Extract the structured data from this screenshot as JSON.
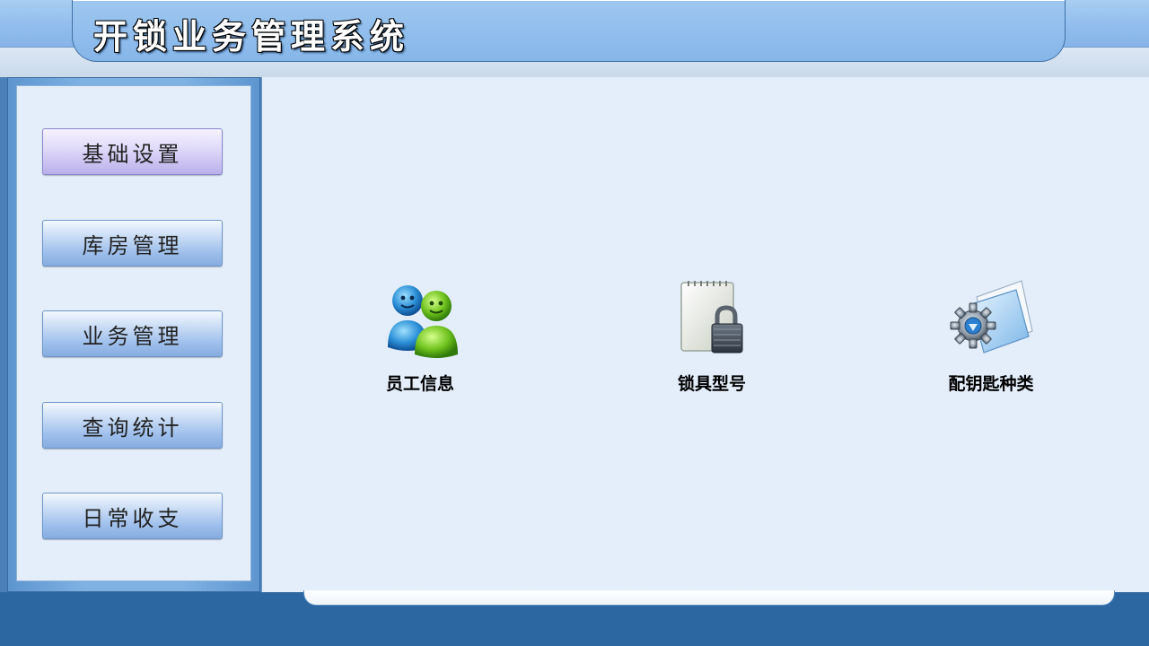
{
  "app": {
    "title": "开锁业务管理系统"
  },
  "sidebar": {
    "items": [
      {
        "label": "基础设置",
        "active": true
      },
      {
        "label": "库房管理",
        "active": false
      },
      {
        "label": "业务管理",
        "active": false
      },
      {
        "label": "查询统计",
        "active": false
      },
      {
        "label": "日常收支",
        "active": false
      }
    ]
  },
  "main": {
    "tiles": [
      {
        "label": "员工信息",
        "icon": "users-icon"
      },
      {
        "label": "锁具型号",
        "icon": "notepad-lock-icon"
      },
      {
        "label": "配钥匙种类",
        "icon": "gear-folder-icon"
      }
    ]
  },
  "colors": {
    "header_blue": "#8fbcec",
    "frame_blue": "#4a7fb8",
    "content_bg": "#e4eefb",
    "active_nav": "#cbc2f1",
    "footer_blue": "#2c67a2"
  }
}
